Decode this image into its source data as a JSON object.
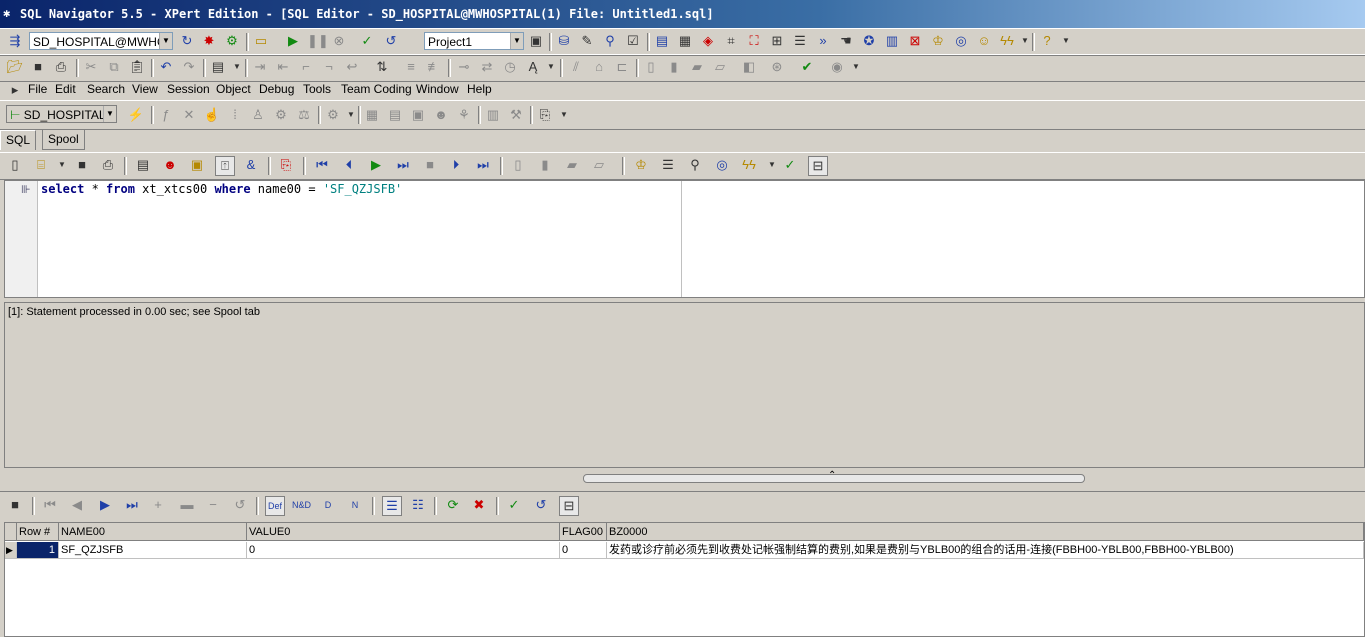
{
  "window": {
    "title": "SQL Navigator 5.5 - XPert Edition - [SQL Editor - SD_HOSPITAL@MWHOSPITAL(1) File: Untitled1.sql]"
  },
  "toolbar1": {
    "connection": "SD_HOSPITAL@MWHOS",
    "project": "Project1"
  },
  "menu": {
    "items": [
      "File",
      "Edit",
      "Search",
      "View",
      "Session",
      "Object",
      "Debug",
      "Tools",
      "Team Coding",
      "Window",
      "Help"
    ]
  },
  "toolbar3": {
    "schema": "SD_HOSPITAL"
  },
  "tabs": [
    "SQL",
    "Spool"
  ],
  "editor": {
    "sql_tokens": [
      {
        "t": "select",
        "k": "kw"
      },
      {
        "t": " * ",
        "k": "op"
      },
      {
        "t": "from",
        "k": "kw"
      },
      {
        "t": " xt_xtcs00 ",
        "k": "id"
      },
      {
        "t": "where",
        "k": "kw"
      },
      {
        "t": " name00 = ",
        "k": "id"
      },
      {
        "t": "'SF_QZJSFB'",
        "k": "str"
      }
    ]
  },
  "messages": {
    "text": "[1]: Statement processed in 0.00 sec; see Spool tab"
  },
  "grid": {
    "columns": [
      "Row #",
      "NAME00",
      "VALUE0",
      "FLAG00",
      "BZ0000"
    ],
    "rows": [
      [
        "1",
        "SF_QZJSFB",
        "0",
        "0",
        "发药或诊疗前必须先到收费处记帐强制结算的费别,如果是费别与YBLB00的组合的话用-连接(FBBH00-YBLB00,FBBH00-YBLB00)"
      ]
    ]
  },
  "colors": {
    "titlebar": "#0a246a",
    "keyword": "#000080",
    "string": "#008080",
    "face": "#d4d0c8"
  }
}
